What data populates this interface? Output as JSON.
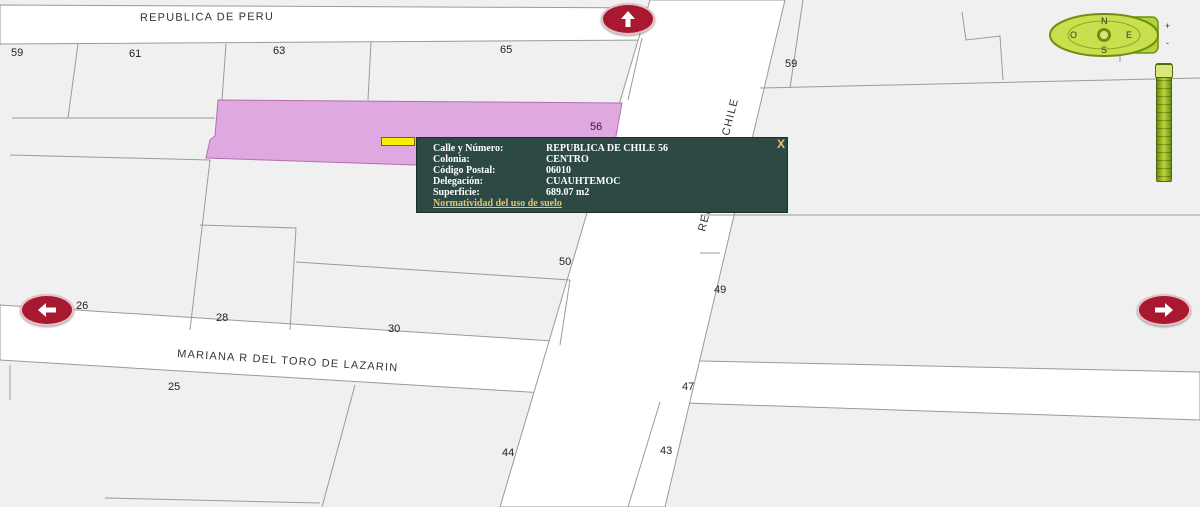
{
  "streets": {
    "north": "REPUBLICA DE PERU",
    "south": "MARIANA R DEL TORO DE LAZARIN",
    "vertical": "REPUBLICA DE CHILE"
  },
  "lot_numbers": {
    "n59_left": "59",
    "n61": "61",
    "n63": "63",
    "n65": "65",
    "n59_right": "59",
    "n56": "56",
    "n50": "50",
    "n49": "49",
    "n26": "26",
    "n28": "28",
    "n30": "30",
    "n25": "25",
    "n47": "47",
    "n44": "44",
    "n43": "43"
  },
  "info_popup": {
    "rows": [
      {
        "label": "Calle y Número:",
        "value": "REPUBLICA DE CHILE 56"
      },
      {
        "label": "Colonia:",
        "value": "CENTRO"
      },
      {
        "label": "Código Postal:",
        "value": "06010"
      },
      {
        "label": "Delegación:",
        "value": "CUAUHTEMOC"
      },
      {
        "label": "Superficie:",
        "value": "689.07 m2"
      }
    ],
    "link": "Normatividad del uso de suelo",
    "close": "X"
  },
  "compass": {
    "n": "N",
    "s": "S",
    "e": "E",
    "o": "O",
    "zoom_in": "+",
    "zoom_out": "-"
  },
  "colors": {
    "highlight_lot": "#e0a8e0",
    "popup_bg": "#2c4a43",
    "nav_button": "#a8192f",
    "marker": "#f4f000",
    "control_green": "#b5d23a"
  },
  "icons": {
    "up": "arrow-up-icon",
    "left": "arrow-left-icon",
    "right": "arrow-right-icon",
    "compass": "compass-icon"
  }
}
